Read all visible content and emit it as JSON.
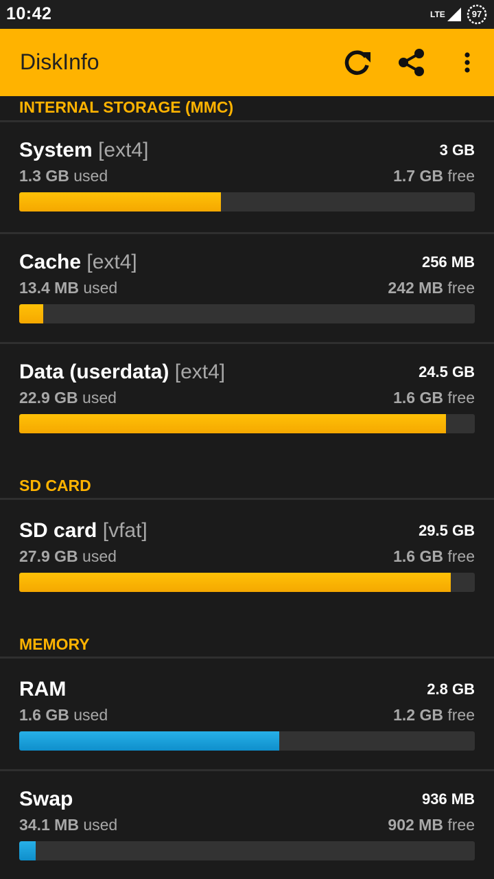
{
  "status_bar": {
    "time": "10:42",
    "network": "LTE",
    "battery": "97",
    "icons": [
      "signal-icon",
      "battery-icon"
    ]
  },
  "app_bar": {
    "title": "DiskInfo",
    "icons": [
      "refresh-icon",
      "share-icon",
      "overflow-menu-icon"
    ],
    "color": "#ffb300"
  },
  "sections": [
    {
      "title": "INTERNAL STORAGE (MMC)",
      "items": [
        {
          "name": "System",
          "fs": "[ext4]",
          "total": "3 GB",
          "used_value": "1.3 GB",
          "used_suffix": " used",
          "free_value": "1.7 GB",
          "free_suffix": " free",
          "fraction": 0.443,
          "color": "#ffb300"
        },
        {
          "name": "Cache",
          "fs": "[ext4]",
          "total": "256 MB",
          "used_value": "13.4 MB",
          "used_suffix": " used",
          "free_value": "242 MB",
          "free_suffix": " free",
          "fraction": 0.052,
          "color": "#ffb300"
        },
        {
          "name": "Data (userdata)",
          "fs": "[ext4]",
          "total": "24.5 GB",
          "used_value": "22.9 GB",
          "used_suffix": " used",
          "free_value": "1.6 GB",
          "free_suffix": " free",
          "fraction": 0.937,
          "color": "#ffb300"
        }
      ]
    },
    {
      "title": "SD CARD",
      "items": [
        {
          "name": "SD card",
          "fs": "[vfat]",
          "total": "29.5 GB",
          "used_value": "27.9 GB",
          "used_suffix": " used",
          "free_value": "1.6 GB",
          "free_suffix": " free",
          "fraction": 0.947,
          "color": "#ffb300"
        }
      ]
    },
    {
      "title": "MEMORY",
      "items": [
        {
          "name": "RAM",
          "fs": "",
          "total": "2.8 GB",
          "used_value": "1.6 GB",
          "used_suffix": " used",
          "free_value": "1.2 GB",
          "free_suffix": " free",
          "fraction": 0.571,
          "color": "#1a9fd9"
        },
        {
          "name": "Swap",
          "fs": "",
          "total": "936 MB",
          "used_value": "34.1 MB",
          "used_suffix": " used",
          "free_value": "902 MB",
          "free_suffix": " free",
          "fraction": 0.036,
          "color": "#1a9fd9"
        }
      ]
    }
  ]
}
